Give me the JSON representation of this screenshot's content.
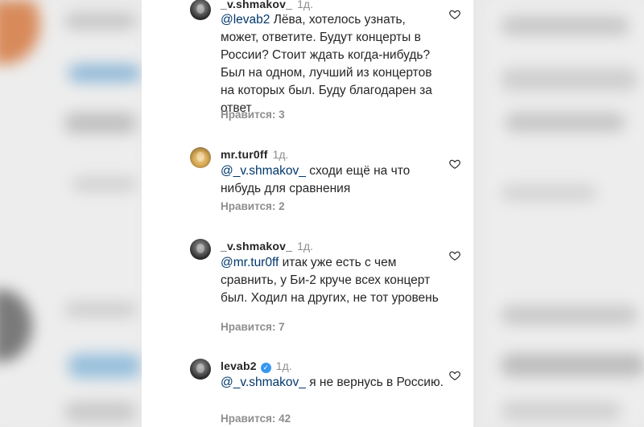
{
  "comments": [
    {
      "username": "_v.shmakov_",
      "time": "1д.",
      "mention": "@levab2",
      "text": " Лёва, хотелось узнать, может, ответите. Будут концерты в России? Стоит ждать когда-нибудь? Был на одном, лучший из концертов на которых был. Буду благодарен за ответ",
      "likes": "Нравится: 3"
    },
    {
      "username": "mr.tur0ff",
      "time": "1д.",
      "mention": "@_v.shmakov_",
      "text": " сходи ещё на что нибудь для сравнения",
      "likes": "Нравится: 2"
    },
    {
      "username": "_v.shmakov_",
      "time": "1д.",
      "mention": "@mr.tur0ff",
      "text": " итак уже есть с чем сравнить, у Би-2 круче всех концерт был. Ходил на других, не тот уровень",
      "likes": "Нравится: 7"
    },
    {
      "username": "levab2",
      "time": "1д.",
      "verified_icon": "verified-badge-icon",
      "mention": "@_v.shmakov_",
      "text": " я не вернусь в Россию.",
      "likes": "Нравится: 42"
    }
  ],
  "colors": {
    "mention": "#00376b",
    "meta": "#8e8e8e",
    "text": "#262626",
    "verified": "#3897f0"
  },
  "icons": {
    "like": "heart-outline-icon"
  }
}
